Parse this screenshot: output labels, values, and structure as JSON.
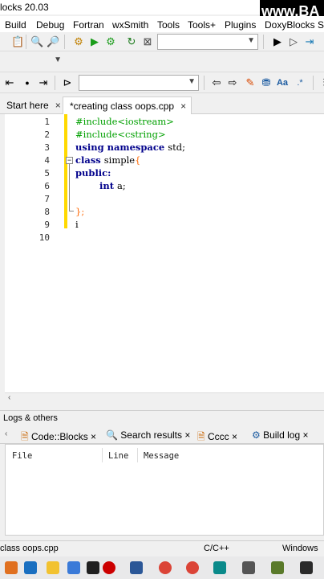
{
  "window": {
    "title": "locks 20.03"
  },
  "watermark": "www.BA",
  "menu": [
    "Build",
    "Debug",
    "Fortran",
    "wxSmith",
    "Tools",
    "Tools+",
    "Plugins",
    "DoxyBlocks",
    "S"
  ],
  "editor_tabs": [
    {
      "label": "Start here",
      "close": "×"
    },
    {
      "label": "*creating class oops.cpp",
      "close": "×"
    }
  ],
  "code": {
    "line_numbers": [
      "1",
      "2",
      "3",
      "4",
      "5",
      "6",
      "7",
      "8",
      "9",
      "10"
    ],
    "lines": [
      {
        "n": "1",
        "text": "#include<iostream>"
      },
      {
        "n": "2",
        "text": "#include<cstring>"
      },
      {
        "n": "3a",
        "text": "using namespace "
      },
      {
        "n": "3b",
        "text": "std;"
      },
      {
        "n": "4a",
        "text": "class "
      },
      {
        "n": "4b",
        "text": "simple"
      },
      {
        "n": "4c",
        "text": "{"
      },
      {
        "n": "5",
        "text": "public:"
      },
      {
        "n": "6a",
        "text": "int "
      },
      {
        "n": "6b",
        "text": "a;"
      },
      {
        "n": "8",
        "text": "};"
      },
      {
        "n": "9",
        "text": "i"
      }
    ]
  },
  "logs": {
    "title": "Logs & others",
    "tabs": [
      "Code::Blocks",
      "Search results",
      "Cccc",
      "Build log"
    ],
    "close": "×",
    "columns": [
      "File",
      "Line",
      "Message"
    ]
  },
  "status": {
    "file": "class oops.cpp",
    "lang": "C/C++",
    "eol": "Windows"
  },
  "colors": {
    "preprocessor": "#00a000",
    "keyword": "#00008b",
    "brace": "#ff6600",
    "changebar": "#ffd900"
  }
}
